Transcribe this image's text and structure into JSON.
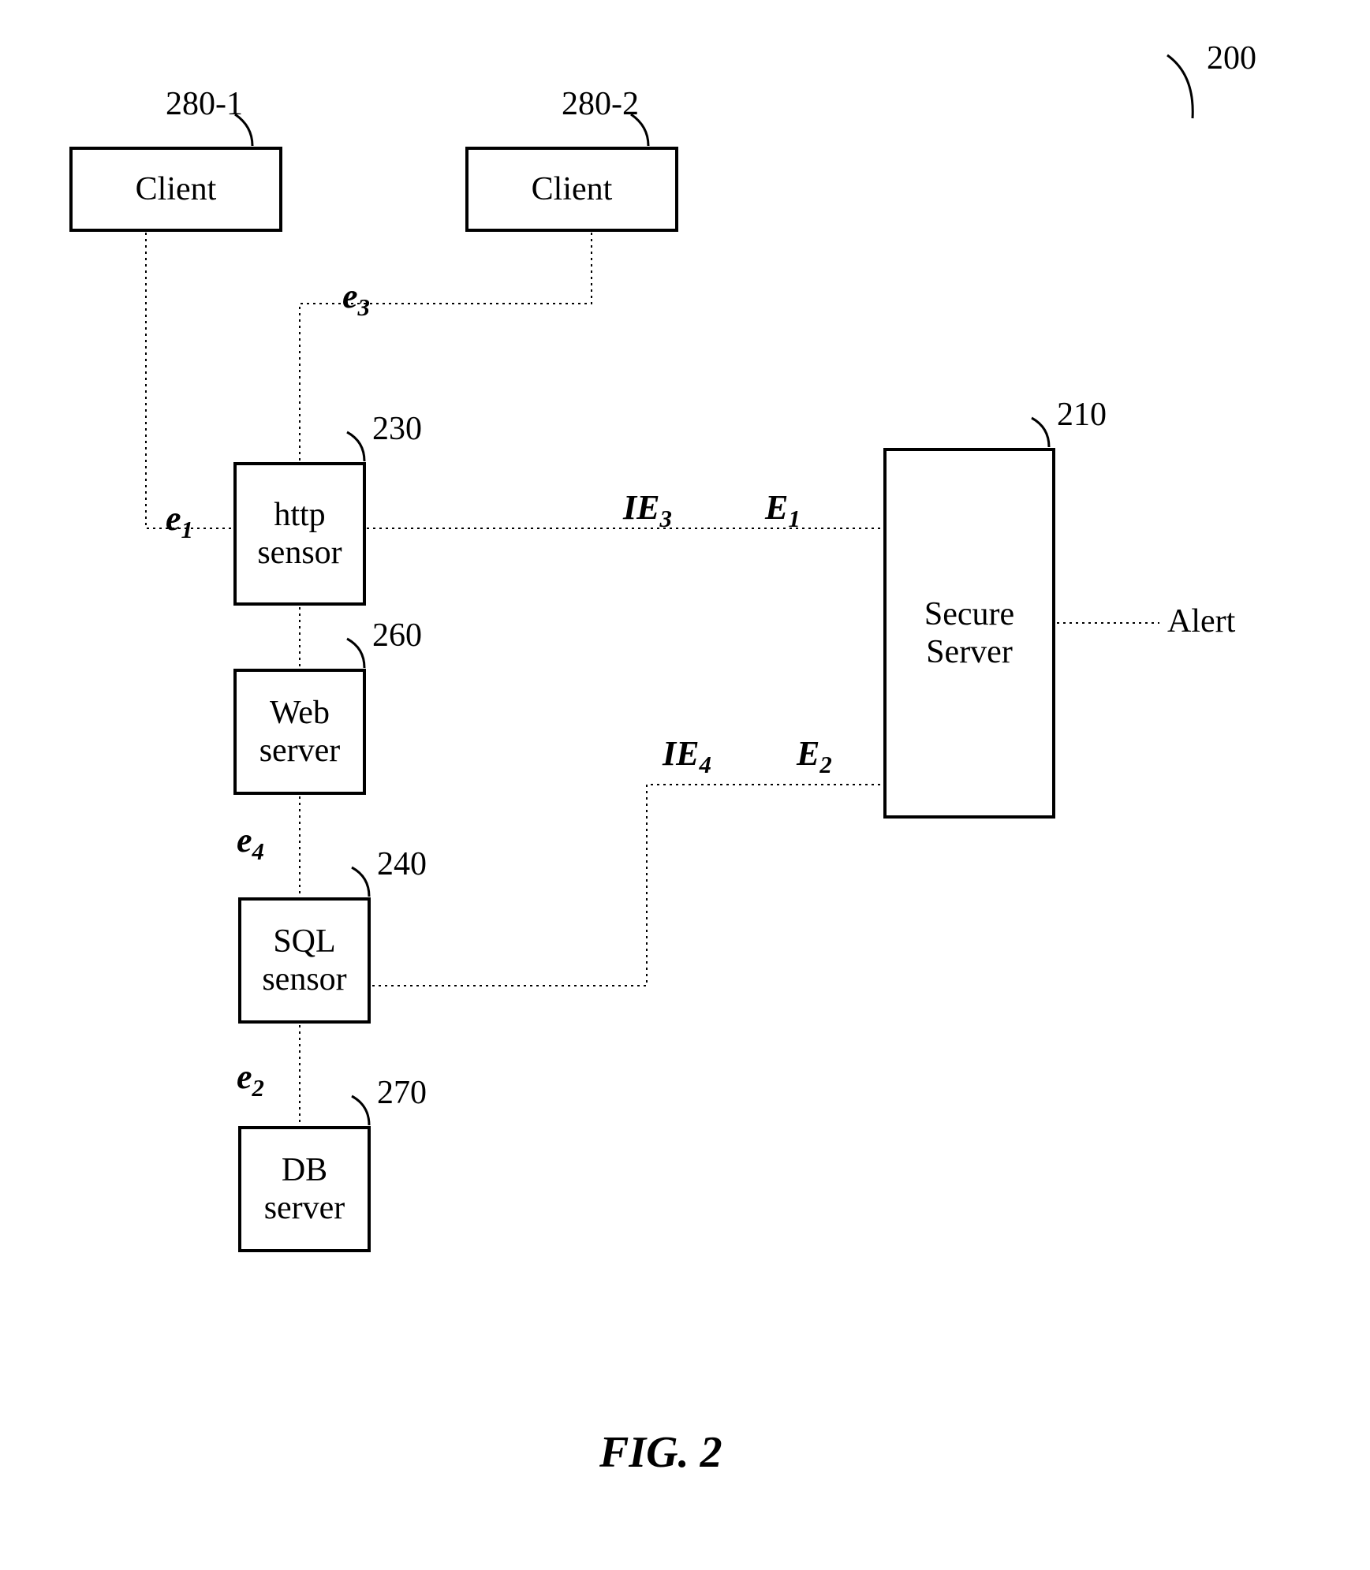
{
  "figure_ref": "200",
  "figure_caption": "FIG. 2",
  "boxes": {
    "client1": {
      "label": "Client",
      "ref": "280-1"
    },
    "client2": {
      "label": "Client",
      "ref": "280-2"
    },
    "http_sensor": {
      "label": "http\nsensor",
      "ref": "230"
    },
    "web_server": {
      "label": "Web\nserver",
      "ref": "260"
    },
    "sql_sensor": {
      "label": "SQL\nsensor",
      "ref": "240"
    },
    "db_server": {
      "label": "DB\nserver",
      "ref": "270"
    },
    "secure_server": {
      "label": "Secure\nServer",
      "ref": "210"
    }
  },
  "edges": {
    "e1": "e",
    "e2": "e",
    "e3": "e",
    "e4": "e",
    "IE3": "IE",
    "IE4": "IE",
    "E1": "E",
    "E2": "E"
  },
  "alert_label": "Alert"
}
